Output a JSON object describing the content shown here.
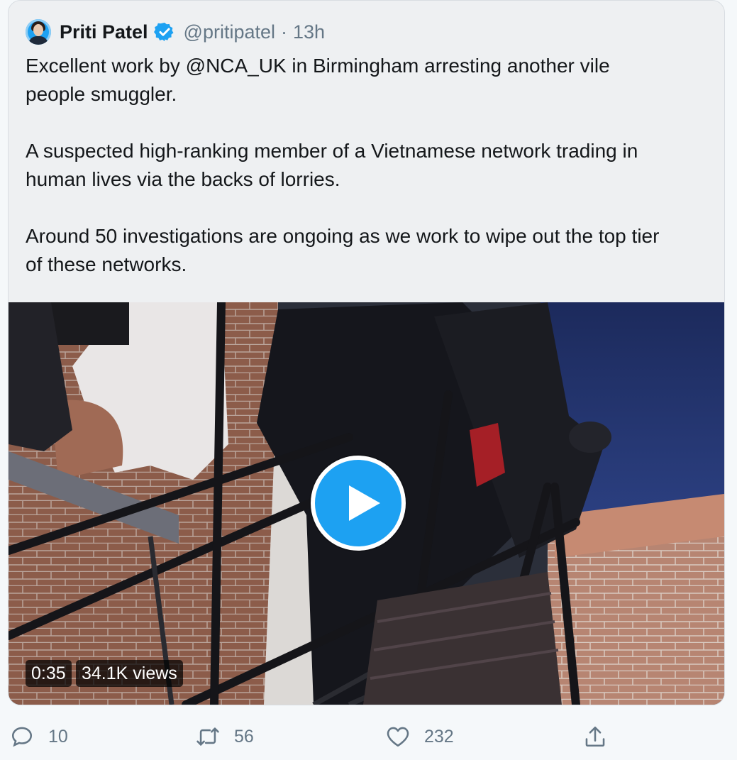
{
  "tweet": {
    "author_name": "Priti Patel",
    "handle": "@pritipatel",
    "separator": "·",
    "time": "13h",
    "text": "Excellent work by @NCA_UK in Birmingham arresting another vile\npeople smuggler.\n\nA suspected high-ranking member of a Vietnamese network trading in\nhuman lives via the backs of lorries.\n\nAround 50 investigations are ongoing as we work to wipe out the top tier\nof these networks."
  },
  "video": {
    "duration": "0:35",
    "views": "34.1K views"
  },
  "actions": {
    "replies": "10",
    "retweets": "56",
    "likes": "232"
  },
  "colors": {
    "accent": "#1da1f2",
    "muted_text": "#657786",
    "card_bg": "#eef0f2"
  },
  "icons": [
    "verified-badge-icon",
    "play-icon",
    "reply-icon",
    "retweet-icon",
    "like-icon",
    "share-icon"
  ]
}
